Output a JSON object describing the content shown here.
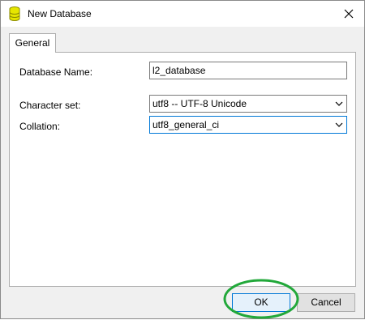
{
  "window": {
    "title": "New Database",
    "icons": {
      "app": "database-icon",
      "close": "close-icon"
    },
    "accent_color": "#0078d7"
  },
  "tabs": [
    {
      "label": "General",
      "selected": true
    }
  ],
  "form": {
    "database_name_label": "Database Name:",
    "database_name_value": "l2_database",
    "charset_label": "Character set:",
    "charset_value": "utf8 -- UTF-8 Unicode",
    "collation_label": "Collation:",
    "collation_value": "utf8_general_ci"
  },
  "buttons": {
    "ok": "OK",
    "cancel": "Cancel"
  },
  "annotation": {
    "color": "#22a83a",
    "shape": "ellipse"
  }
}
